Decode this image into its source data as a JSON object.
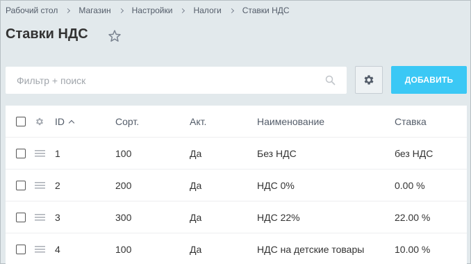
{
  "breadcrumb": [
    "Рабочий стол",
    "Магазин",
    "Настройки",
    "Налоги",
    "Ставки НДС"
  ],
  "page_title": "Ставки НДС",
  "search": {
    "placeholder": "Фильтр + поиск"
  },
  "add_button_label": "ДОБАВИТЬ",
  "table": {
    "headers": {
      "id": "ID",
      "sort": "Сорт.",
      "active": "Акт.",
      "name": "Наименование",
      "rate": "Ставка"
    },
    "rows": [
      {
        "id": "1",
        "sort": "100",
        "active": "Да",
        "name": "Без НДС",
        "rate": "без НДС"
      },
      {
        "id": "2",
        "sort": "200",
        "active": "Да",
        "name": "НДС 0%",
        "rate": "0.00 %"
      },
      {
        "id": "3",
        "sort": "300",
        "active": "Да",
        "name": "НДС 22%",
        "rate": "22.00 %"
      },
      {
        "id": "4",
        "sort": "100",
        "active": "Да",
        "name": "НДС на детские товары",
        "rate": "10.00 %"
      }
    ]
  },
  "icons": [
    "star-icon",
    "search-icon",
    "gear-icon",
    "drag-handle-icon",
    "sort-asc-icon"
  ],
  "colors": {
    "accent": "#3bc8f5",
    "background": "#e2e9ec"
  }
}
